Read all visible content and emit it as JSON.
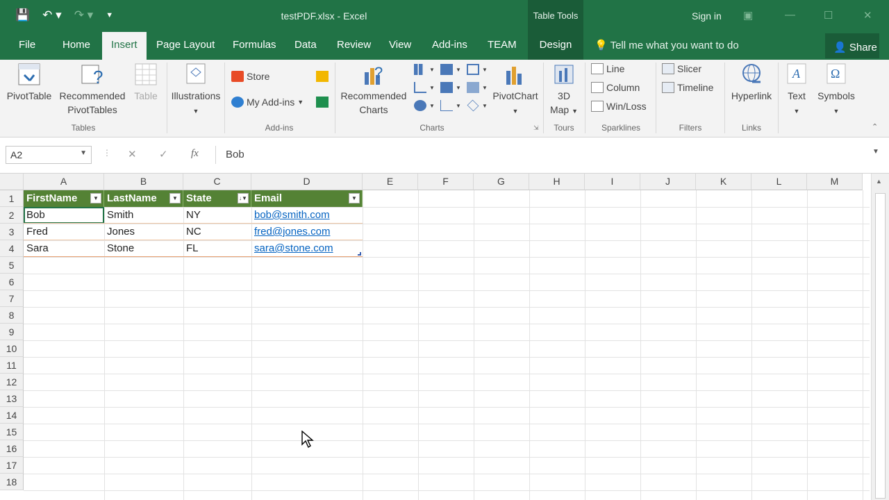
{
  "app": {
    "title": "testPDF.xlsx - Excel",
    "table_tools": "Table Tools",
    "sign_in": "Sign in"
  },
  "tabs": [
    "File",
    "Home",
    "Insert",
    "Page Layout",
    "Formulas",
    "Data",
    "Review",
    "View",
    "Add-ins",
    "TEAM",
    "Design"
  ],
  "active_tab": "Insert",
  "tell_me": "Tell me what you want to do",
  "share": "Share",
  "ribbon": {
    "pivottable": "PivotTable",
    "recommended_pivot": "Recommended",
    "recommended_pivot2": "PivotTables",
    "table": "Table",
    "illustrations": "Illustrations",
    "store": "Store",
    "my_addins": "My Add-ins",
    "recommended_charts": "Recommended",
    "recommended_charts2": "Charts",
    "pivotchart": "PivotChart",
    "map3d": "3D",
    "map3d2": "Map",
    "line": "Line",
    "column": "Column",
    "winloss": "Win/Loss",
    "slicer": "Slicer",
    "timeline": "Timeline",
    "hyperlink": "Hyperlink",
    "text": "Text",
    "symbols": "Symbols",
    "groups": {
      "tables": "Tables",
      "addins": "Add-ins",
      "charts": "Charts",
      "tours": "Tours",
      "sparklines": "Sparklines",
      "filters": "Filters",
      "links": "Links"
    }
  },
  "formula_bar": {
    "name_box": "A2",
    "fx": "fx",
    "value": "Bob"
  },
  "columns": [
    "A",
    "B",
    "C",
    "D",
    "E",
    "F",
    "G",
    "H",
    "I",
    "J",
    "K",
    "L",
    "M"
  ],
  "rows": [
    "1",
    "2",
    "3",
    "4",
    "5",
    "6",
    "7",
    "8",
    "9",
    "10",
    "11",
    "12",
    "13",
    "14",
    "15",
    "16",
    "17",
    "18"
  ],
  "table": {
    "headers": [
      "FirstName",
      "LastName",
      "State",
      "Email"
    ],
    "data": [
      [
        "Bob",
        "Smith",
        "NY",
        "bob@smith.com"
      ],
      [
        "Fred",
        "Jones",
        "NC",
        "fred@jones.com"
      ],
      [
        "Sara",
        "Stone",
        "FL",
        "sara@stone.com"
      ]
    ]
  },
  "colors": {
    "excel_green": "#217346",
    "table_header": "#548235",
    "link": "#0563c1"
  }
}
